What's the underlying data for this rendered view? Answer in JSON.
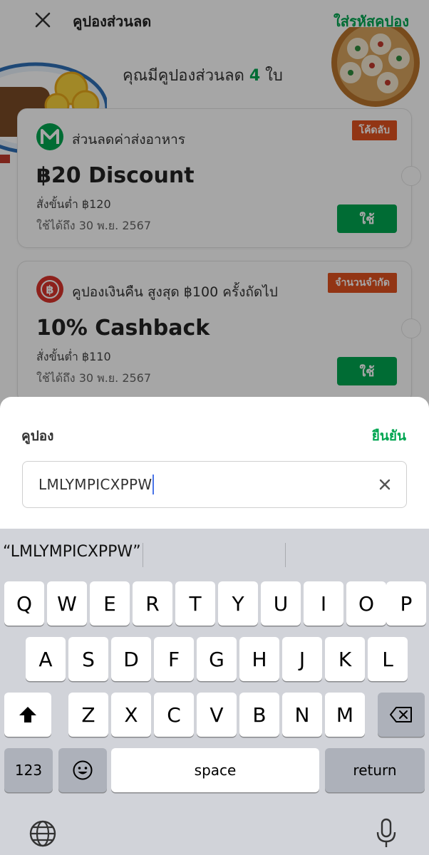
{
  "header": {
    "title": "คูปองส่วนลด",
    "enter_code_link": "ใส่รหัสคูปอง"
  },
  "summary": {
    "prefix": "คุณมีคูปองส่วนลด",
    "count": "4",
    "suffix": "ใบ"
  },
  "coupons": [
    {
      "subtitle": "ส่วนลดค่าส่งอาหาร",
      "badge": "โค้ดลับ",
      "amount": "฿20 Discount",
      "min_order": "สั่งขั้นต่ำ ฿120",
      "expiry": "ใช้ได้ถึง 30 พ.ย. 2567",
      "use_label": "ใช้",
      "icon": "lineman-logo-icon"
    },
    {
      "subtitle": "คูปองเงินคืน สูงสุด ฿100 ครั้งถัดไป",
      "badge": "จำนวนจำกัด",
      "amount": "10% Cashback",
      "min_order": "สั่งขั้นต่ำ ฿110",
      "expiry": "ใช้ได้ถึง 30 พ.ย. 2567",
      "use_label": "ใช้",
      "icon": "baht-coin-icon"
    }
  ],
  "sheet": {
    "title": "คูปอง",
    "confirm_label": "ยืนยัน",
    "code_value": "LMLYMPICXPPW"
  },
  "keyboard": {
    "suggestion": "“LMLYMPICXPPW”",
    "row1": [
      "Q",
      "W",
      "E",
      "R",
      "T",
      "Y",
      "U",
      "I",
      "O",
      "P"
    ],
    "row2": [
      "A",
      "S",
      "D",
      "F",
      "G",
      "H",
      "J",
      "K",
      "L"
    ],
    "row3": [
      "Z",
      "X",
      "C",
      "V",
      "B",
      "N",
      "M"
    ],
    "numbers_label": "123",
    "space_label": "space",
    "return_label": "return"
  },
  "colors": {
    "accent_green": "#00A651",
    "badge_orange": "#E0521F"
  }
}
